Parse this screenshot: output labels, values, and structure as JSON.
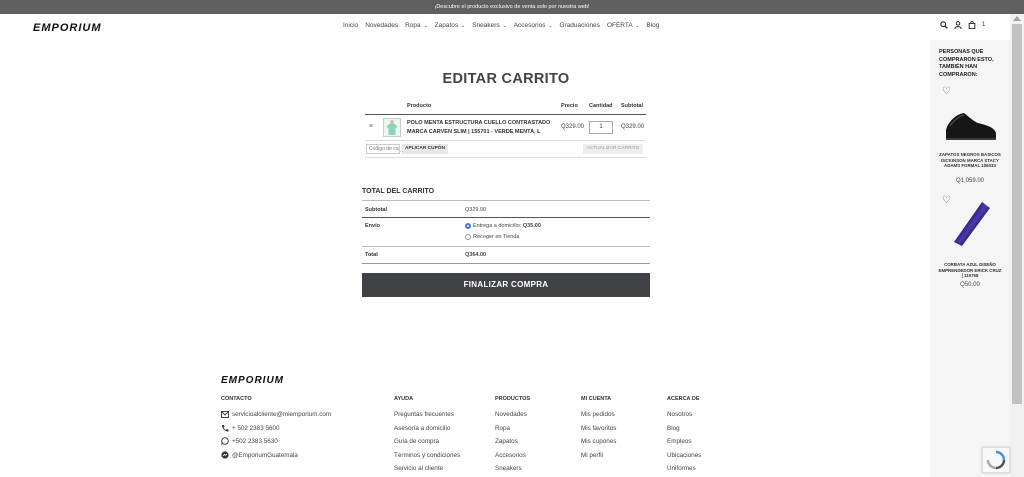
{
  "topbar": {
    "text": "¡Descubre el producto exclusivo de venta solo por nuestra web!"
  },
  "header": {
    "logo": "EMPORIUM",
    "nav": [
      {
        "label": "Inicio",
        "has_caret": false
      },
      {
        "label": "Novedades",
        "has_caret": false
      },
      {
        "label": "Ropa",
        "has_caret": true
      },
      {
        "label": "Zapatos",
        "has_caret": true
      },
      {
        "label": "Sneakers",
        "has_caret": true
      },
      {
        "label": "Accesorios",
        "has_caret": true
      },
      {
        "label": "Graduaciones",
        "has_caret": false
      },
      {
        "label": "OFERTA",
        "has_caret": true
      },
      {
        "label": "Blog",
        "has_caret": false
      }
    ],
    "cart_count": "1"
  },
  "page": {
    "title": "EDITAR CARRITO"
  },
  "cart": {
    "headers": {
      "product": "Producto",
      "price": "Precio",
      "quantity": "Cantidad",
      "subtotal": "Subtotal"
    },
    "item": {
      "remove": "×",
      "name": "POLO MENTA ESTRUCTURA CUELLO CONTRASTADO MARCA CARVEN SLIM | 155701 - VERDE MENTA, L",
      "price": "Q329.00",
      "quantity": "1",
      "subtotal": "Q329.00"
    },
    "coupon_placeholder": "Código de cupón",
    "apply_coupon": "APLICAR CUPÓN",
    "update_cart": "ACTUALIZAR CARRITO"
  },
  "totals": {
    "title": "TOTAL DEL CARRITO",
    "subtotal_label": "Subtotal",
    "subtotal_value": "Q329.00",
    "shipping_label": "Envío",
    "shipping_option1": "Entrega a domicilio:",
    "shipping_option1_price": "Q35.00",
    "shipping_option2": "Recoger en Tienda",
    "total_label": "Total",
    "total_value": "Q364.00",
    "checkout": "FINALIZAR COMPRA"
  },
  "side": {
    "title": "PERSONAS QUE COMPRARON ESTO, TAMBIÉN HAN COMPRARON:",
    "products": [
      {
        "name": "ZAPATOS NEGROS BASICOS DICKINSON MARCA STACY ADAMS FORMAL 106033",
        "price": "Q1,059.00"
      },
      {
        "name": "CORBATA AZUL DISEÑO EMPRENDEDOR ERICK CRUZ | 119768",
        "price": "Q50.00"
      }
    ]
  },
  "footer": {
    "logo": "EMPORIUM",
    "contact": {
      "heading": "CONTACTO",
      "email": "servicioalcliente@miemporium.com",
      "phone": "+ 502 2383 5600",
      "whatsapp": "+502 2383 5630",
      "messenger": "@EmporiumGuatemala"
    },
    "ayuda": {
      "heading": "AYUDA",
      "items": [
        "Preguntas frecuentes",
        "Asesoría a domicilio",
        "Guía de compra",
        "Términos y condiciones",
        "Servicio al cliente"
      ]
    },
    "productos": {
      "heading": "PRODUCTOS",
      "items": [
        "Novedades",
        "Ropa",
        "Zapatos",
        "Accesorios",
        "Sneakers"
      ]
    },
    "micuenta": {
      "heading": "MI CUENTA",
      "items": [
        "Mis pedidos",
        "Mis favoritos",
        "Mis cupones",
        "Mi perfil"
      ]
    },
    "acerca": {
      "heading": "ACERCA DE",
      "items": [
        "Nosotros",
        "Blog",
        "Empleos",
        "Ubicaciones",
        "Uniformes"
      ]
    }
  },
  "colors": {
    "topbar": "#5f5f5f",
    "checkout_button": "#404245",
    "side_panel": "#f5f5f5",
    "tie": "#3a2a8a"
  }
}
